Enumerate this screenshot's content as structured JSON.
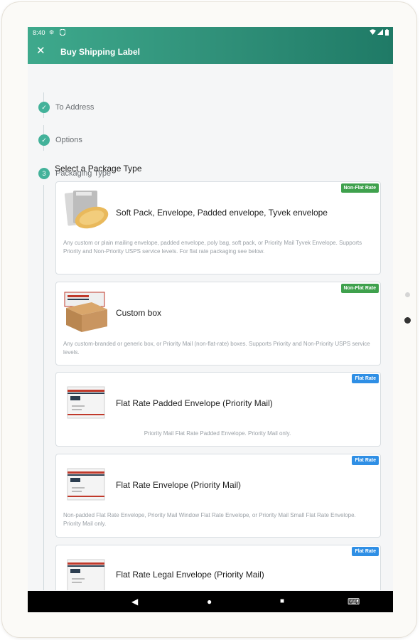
{
  "statusbar": {
    "time": "8:40"
  },
  "appbar": {
    "close_glyph": "✕",
    "title": "Buy Shipping Label"
  },
  "steps": [
    {
      "label": "To Address",
      "state": "done",
      "glyph": "✓"
    },
    {
      "label": "Options",
      "state": "done",
      "glyph": "✓"
    },
    {
      "label": "Packaging Type",
      "state": "active",
      "glyph": "3"
    }
  ],
  "section_title": "Select a Package Type",
  "packages": [
    {
      "title": "Soft Pack, Envelope, Padded envelope, Tyvek envelope",
      "badge": "Non-Flat Rate",
      "badge_color": "#3fa14d",
      "description": "Any custom or plain mailing envelope, padded envelope, poly bag, soft pack, or Priority Mail Tyvek Envelope. Supports Priority and Non-Priority USPS service levels. For flat rate packaging see below."
    },
    {
      "title": "Custom box",
      "badge": "Non-Flat Rate",
      "badge_color": "#3fa14d",
      "description": "Any custom-branded or generic box, or Priority Mail (non-flat-rate) boxes. Supports Priority and Non-Priority USPS service levels."
    },
    {
      "title": "Flat Rate Padded Envelope (Priority Mail)",
      "badge": "Flat Rate",
      "badge_color": "#2f8fe5",
      "description": "Priority Mail Flat Rate Padded Envelope. Priority Mail only."
    },
    {
      "title": "Flat Rate Envelope (Priority Mail)",
      "badge": "Flat Rate",
      "badge_color": "#2f8fe5",
      "description": "Non-padded Flat Rate Envelope, Priority Mail Window Flat Rate Envelope, or Priority Mail Small Flat Rate Envelope. Priority Mail only."
    },
    {
      "title": "Flat Rate Legal Envelope (Priority Mail)",
      "badge": "Flat Rate",
      "badge_color": "#2f8fe5",
      "description": ""
    }
  ],
  "navbar": {
    "back_glyph": "◀",
    "home_glyph": "●",
    "recents_glyph": "■",
    "keyboard_glyph": "⌨"
  },
  "colors": {
    "accent": "#3ea98c",
    "non_flat_badge": "#3fa14d",
    "flat_badge": "#2f8fe5"
  },
  "icons": [
    "settings-icon",
    "shield-icon",
    "wifi-icon",
    "signal-icon",
    "battery-icon",
    "close-icon",
    "check-icon"
  ]
}
